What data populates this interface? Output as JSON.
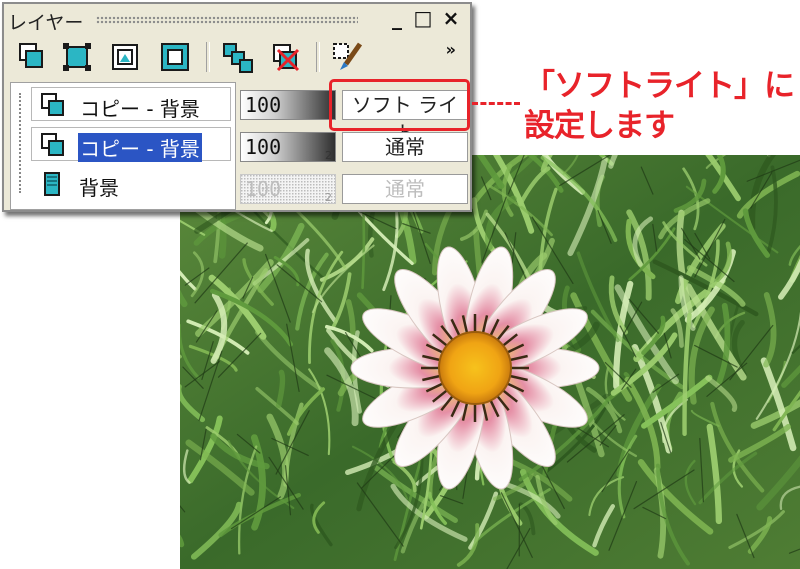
{
  "window": {
    "title": "レイヤー",
    "minimize": "_",
    "maximize": "□",
    "close": "×",
    "toolbar_overflow": "»"
  },
  "toolbar": {
    "buttons": [
      "new-layer-icon",
      "layer-transform-icon",
      "layer-mask-icon",
      "layer-copy-icon",
      "link-layers-icon",
      "delete-layer-icon",
      "layer-brush-icon"
    ]
  },
  "layers": [
    {
      "name": "コピー - 背景",
      "opacity": "100",
      "blend": "ソフト ライト",
      "selected": false
    },
    {
      "name": "コピー - 背景",
      "opacity": "100",
      "blend": "通常",
      "selected": true
    },
    {
      "name": "背景",
      "opacity": "100",
      "blend": "通常",
      "selected": false,
      "faded": true
    }
  ],
  "annotation": {
    "line1": "「ソフトライト」に",
    "line2": "設定します",
    "color": "#e8232a"
  },
  "photo": {
    "subject": "flower-photo"
  }
}
